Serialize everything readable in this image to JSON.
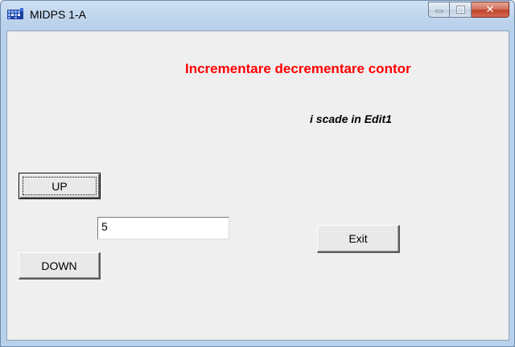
{
  "window": {
    "title": "MIDPS 1-A",
    "app_icon": "calculator-grid-icon",
    "controls": {
      "minimize_icon": "minimize-icon",
      "maximize_icon": "maximize-icon",
      "close_icon": "close-icon",
      "close_glyph": "✕"
    }
  },
  "form": {
    "heading": "Incrementare decrementare contor",
    "hint": "i scade in Edit1",
    "up_label": "UP",
    "down_label": "DOWN",
    "exit_label": "Exit",
    "edit_value": "5"
  },
  "colors": {
    "heading": "#ff0000",
    "close_button": "#c0432b"
  }
}
